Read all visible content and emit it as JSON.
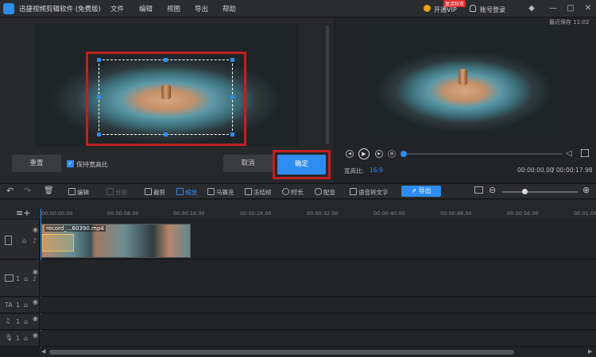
{
  "app": {
    "title": "迅捷视频剪辑软件 (免费版)",
    "menu": [
      "文件",
      "编辑",
      "视图",
      "导出",
      "帮助"
    ],
    "vip_badge": "复活狂欢",
    "vip_label": "开通VIP",
    "login_label": "账号登录"
  },
  "crop": {
    "reset_label": "重置",
    "keep_ratio_label": "保持宽高比",
    "keep_ratio_checked": true,
    "cancel_label": "取消",
    "confirm_label": "确定"
  },
  "preview": {
    "last_saved": "最近保存 11:02",
    "ratio_label": "宽高比:",
    "ratio_value": "16:9",
    "time_current": "00:00:00.00",
    "time_total": "/ 00:00:17.98",
    "progress": 0.0
  },
  "toolbar": {
    "edit": "编辑",
    "split": "分割",
    "crop": "裁剪",
    "zoom": "缩放",
    "mosaic": "马赛克",
    "freeze": "冻结帧",
    "duration": "时长",
    "dub": "配音",
    "speech_to_text": "语音转文字",
    "export": "导出"
  },
  "timeline": {
    "ruler": [
      "00:00:00.00",
      "00:00:08.00",
      "00:00:16.00",
      "00:00:24.00",
      "00:00:32.00",
      "00:00:40.00",
      "00:00:48.00",
      "00:00:56.00",
      "00:01:04"
    ],
    "clip_name": "record_...60390.mp4",
    "track_numbers": [
      "1",
      "1",
      "1",
      "1"
    ]
  },
  "colors": {
    "accent": "#2d8cf0",
    "highlight_red": "#c0201f",
    "background": "#1e1f22"
  }
}
